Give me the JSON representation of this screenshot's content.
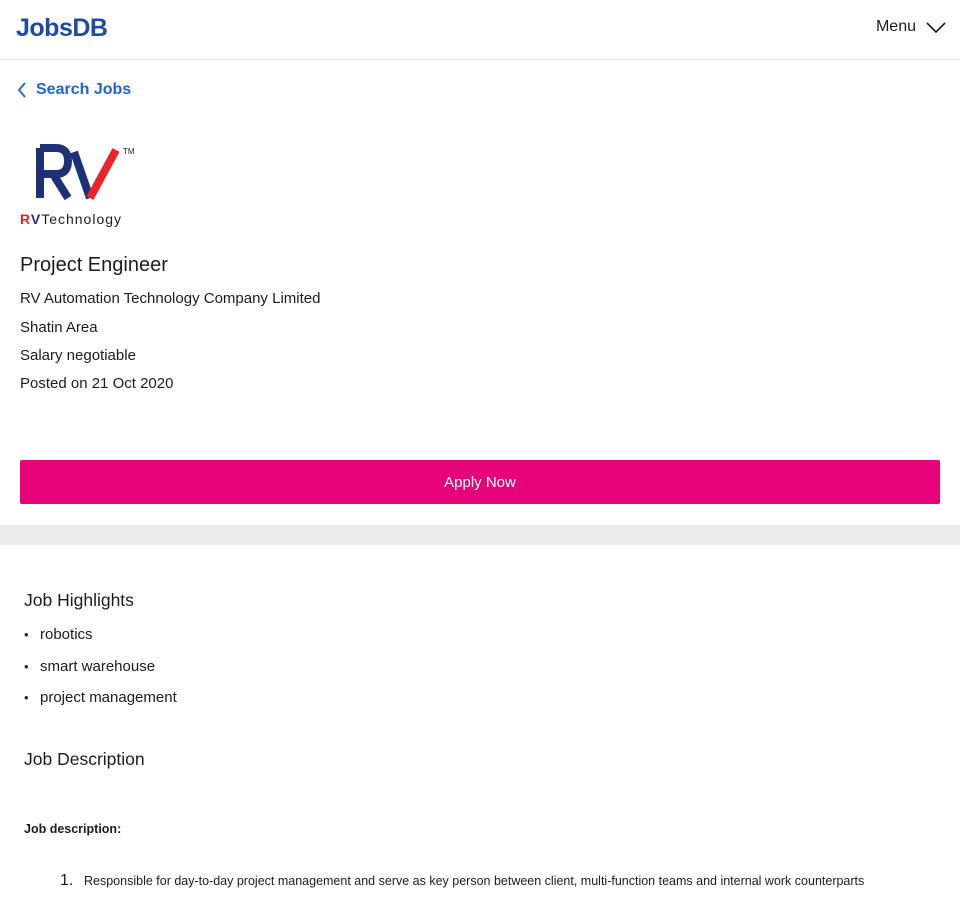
{
  "header": {
    "logo_text": "JobsDB",
    "menu_label": "Menu"
  },
  "nav": {
    "back_label": "Search Jobs"
  },
  "job": {
    "logo_text": "RVTechnology",
    "title": "Project Engineer",
    "company": "RV Automation Technology Company Limited",
    "location": "Shatin Area",
    "salary": "Salary negotiable",
    "posted": "Posted on 21 Oct 2020"
  },
  "apply_label": "Apply Now",
  "highlights": {
    "title": "Job Highlights",
    "items": [
      "robotics",
      "smart warehouse",
      "project management"
    ]
  },
  "description": {
    "title": "Job Description",
    "heading": "Job description:",
    "items": [
      {
        "number": "1.",
        "text": "Responsible for day-to-day project management and serve as key person between client, multi-function teams and internal work counterparts"
      }
    ]
  },
  "colors": {
    "brand_blue": "#1c4da1",
    "link_blue": "#2065d1",
    "apply_pink": "#e60278",
    "logo_navy": "#1e3178",
    "logo_red": "#e8232a"
  },
  "icons": {
    "menu": "chevron-down-icon",
    "back": "chevron-left-icon"
  }
}
